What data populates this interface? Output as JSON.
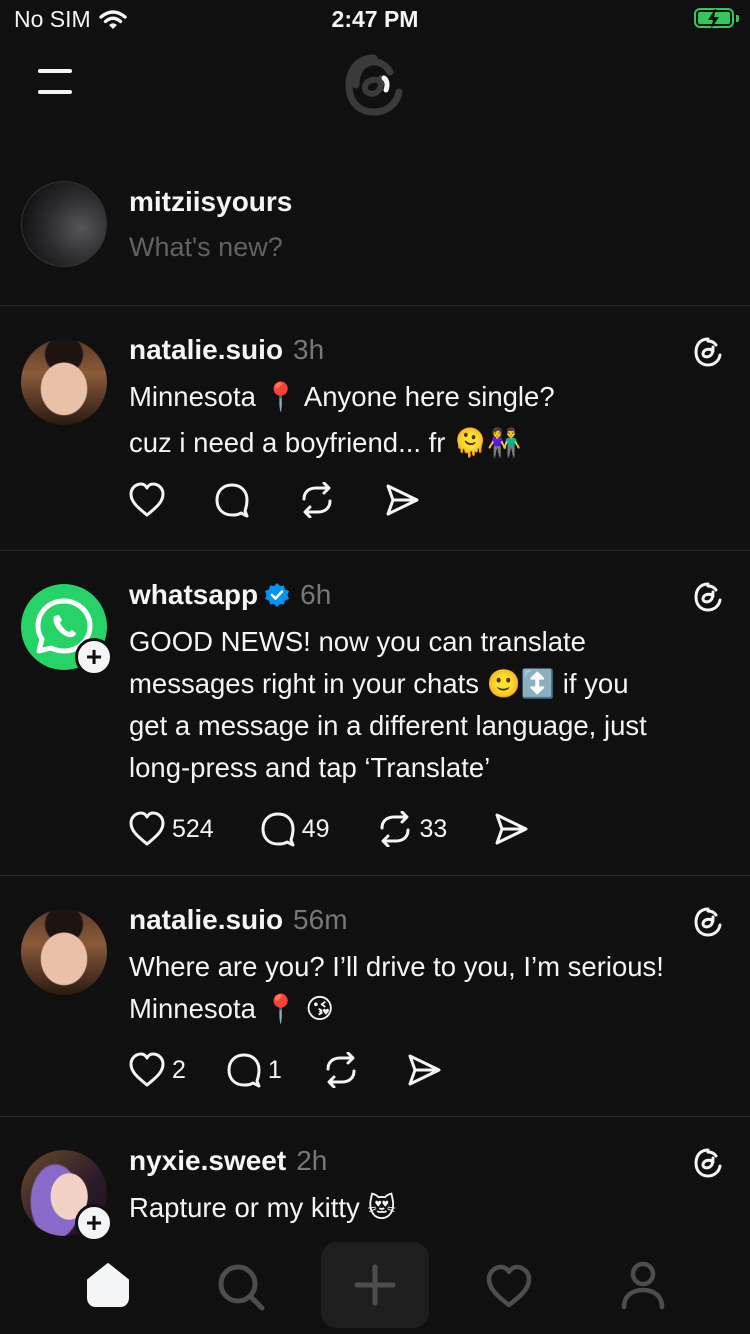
{
  "status_bar": {
    "carrier": "No SIM",
    "time": "2:47 PM"
  },
  "composer": {
    "username": "mitziisyours",
    "placeholder": "What's new?"
  },
  "posts": [
    {
      "username": "natalie.suio",
      "time": "3h",
      "verified": false,
      "lines": [
        "Minnesota 📍 Anyone here single?",
        "cuz i need a boyfriend... fr 🫠👫"
      ],
      "likes": "",
      "replies": "",
      "reposts": ""
    },
    {
      "username": "whatsapp",
      "time": "6h",
      "verified": true,
      "lines": [
        "GOOD NEWS! now you can translate",
        "messages right in your chats 🙂↕️ if you",
        "get a message in a different language, just",
        "long-press and tap ‘Translate’"
      ],
      "likes": "524",
      "replies": "49",
      "reposts": "33"
    },
    {
      "username": "natalie.suio",
      "time": "56m",
      "verified": false,
      "lines": [
        "Where are you? I’ll drive to you, I’m serious!",
        "Minnesota 📍 😘"
      ],
      "likes": "2",
      "replies": "1",
      "reposts": ""
    },
    {
      "username": "nyxie.sweet",
      "time": "2h",
      "verified": false,
      "lines": [
        "Rapture or my kitty 😻"
      ],
      "likes": "",
      "replies": "",
      "reposts": ""
    }
  ],
  "tab_bar": {
    "items": [
      {
        "icon": "home-icon",
        "active": true
      },
      {
        "icon": "search-icon",
        "active": false
      },
      {
        "icon": "plus-icon",
        "active": false
      },
      {
        "icon": "heart-icon",
        "active": false
      },
      {
        "icon": "profile-icon",
        "active": false
      }
    ]
  },
  "colors": {
    "background": "#101010",
    "text": "#f3f5f7",
    "muted": "#777777",
    "verified": "#0095f6",
    "whatsapp": "#25d366",
    "battery": "#34c759"
  }
}
